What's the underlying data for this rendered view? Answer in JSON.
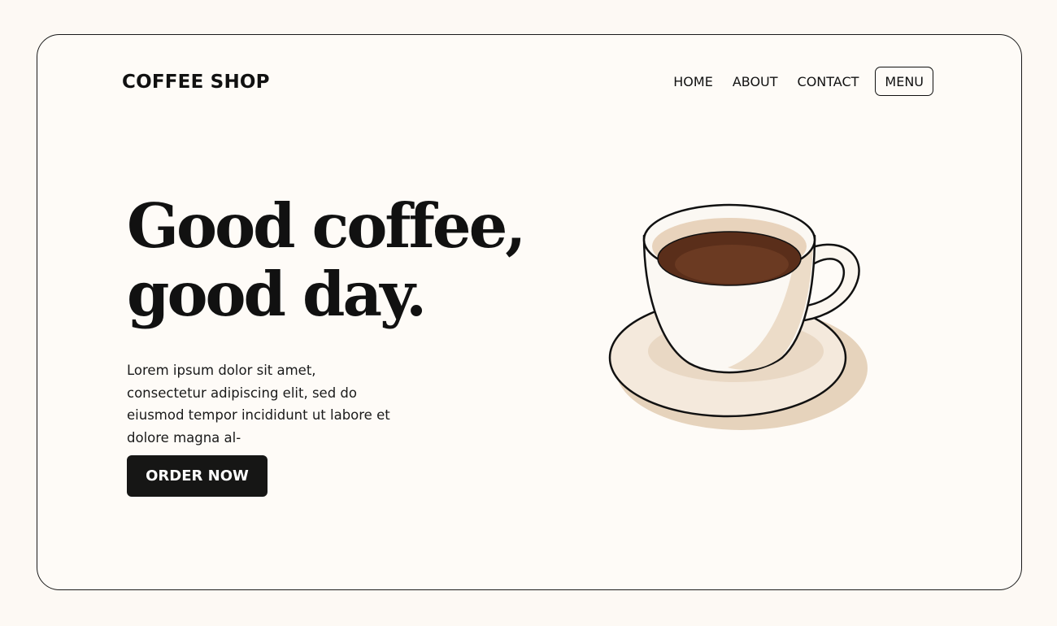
{
  "header": {
    "brand": "COFFEE SHOP",
    "nav": {
      "home": "HOME",
      "about": "ABOUT",
      "contact": "CONTACT",
      "menu_button": "MENU"
    }
  },
  "hero": {
    "headline_line1": "Good coffee,",
    "headline_line2": "good day.",
    "body": "Lorem ipsum dolor sit amet, consectetur adipiscing elit, sed do eiusmod tempor incididunt ut labore et dolore magna al-",
    "cta_label": "ORDER NOW",
    "illustration": "coffee-cup-illustration"
  },
  "colors": {
    "background": "#fdf9f4",
    "text": "#111111",
    "button": "#161615",
    "coffee": "#5a2e1a",
    "cup_shadow": "#e6d3bc"
  }
}
